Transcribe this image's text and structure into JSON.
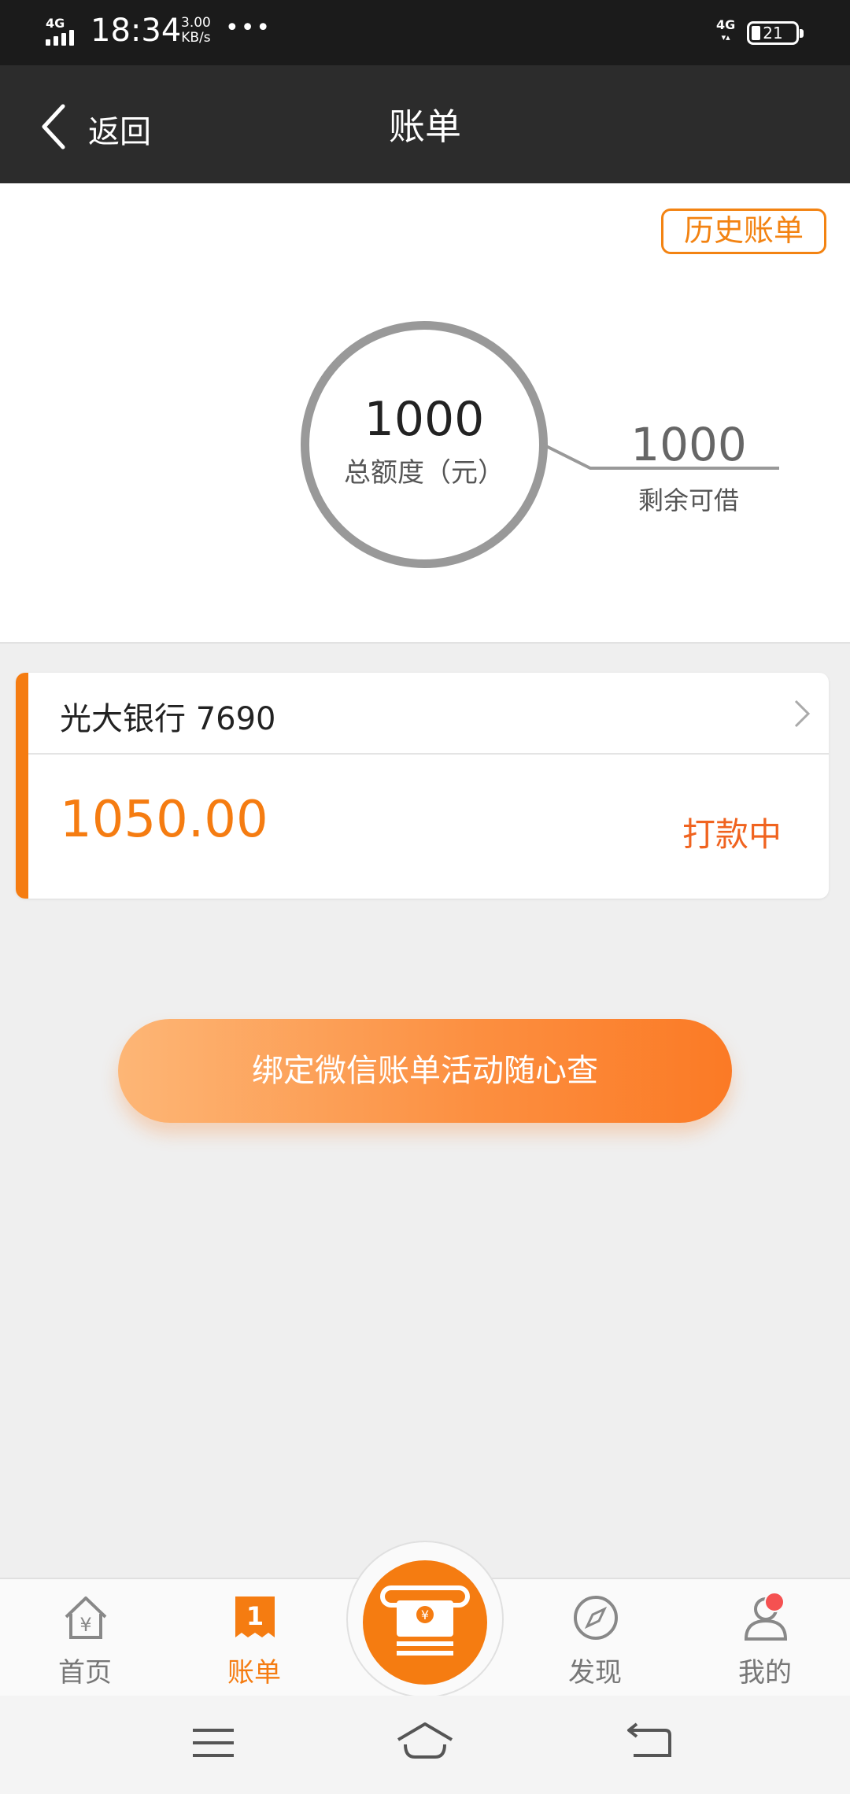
{
  "status_bar": {
    "network_left": "4G",
    "time": "18:34",
    "speed_value": "3.00",
    "speed_unit": "KB/s",
    "more": "•••",
    "network_right": "4G",
    "battery": "21"
  },
  "nav": {
    "back_label": "返回",
    "title": "账单"
  },
  "credit": {
    "history_label": "历史账单",
    "total_amount": "1000",
    "total_label": "总额度（元）",
    "remaining_amount": "1000",
    "remaining_label": "剩余可借"
  },
  "bill_card": {
    "bank": "光大银行 7690",
    "amount": "1050.00",
    "status": "打款中"
  },
  "bind_button": {
    "label": "绑定微信账单活动随心查"
  },
  "tab_bar": {
    "tabs": [
      {
        "label": "首页",
        "icon": "home-icon",
        "active": false
      },
      {
        "label": "账单",
        "icon": "bill-icon",
        "active": true
      },
      {
        "label": "发现",
        "icon": "compass-icon",
        "active": false
      },
      {
        "label": "我的",
        "icon": "user-icon",
        "active": false
      }
    ],
    "center_icon": "cash-icon",
    "bill_icon_text": "1"
  },
  "system_nav": [
    "menu-icon",
    "home-outline-icon",
    "back-icon"
  ],
  "colors": {
    "accent": "#f57c11",
    "status_text": "#f0631f",
    "header_bg": "#2c2c2c",
    "page_bg": "#efefef"
  }
}
